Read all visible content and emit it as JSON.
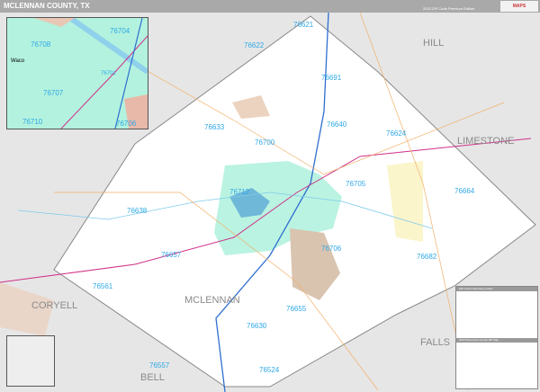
{
  "header": {
    "title": "MCLENNAN COUNTY, TX",
    "edition": "2023 ZIP Code Premium Edition",
    "logo": "MAPS"
  },
  "zips": [
    "76621",
    "76622",
    "76691",
    "76633",
    "76640",
    "76624",
    "76700",
    "76705",
    "76664",
    "76712",
    "76638",
    "76706",
    "76682",
    "76657",
    "76561",
    "76655",
    "76630",
    "76557",
    "76524"
  ],
  "counties": [
    "HILL",
    "LIMESTONE",
    "CORYELL",
    "MCLENNAN",
    "FALLS",
    "BELL"
  ],
  "inset": {
    "city": "Waco",
    "zips": [
      "76704",
      "76708",
      "76701",
      "76707",
      "76710",
      "76706"
    ]
  },
  "legend": {
    "table_title": "ZIP Code Index/City Locator",
    "map_title": "2023 McLennan County ZIP Map"
  },
  "colors": {
    "zip_label": "#2fa8e8",
    "county_fill": "#ffffff",
    "background": "#e6e6e6",
    "waco": "#b3f2de"
  }
}
